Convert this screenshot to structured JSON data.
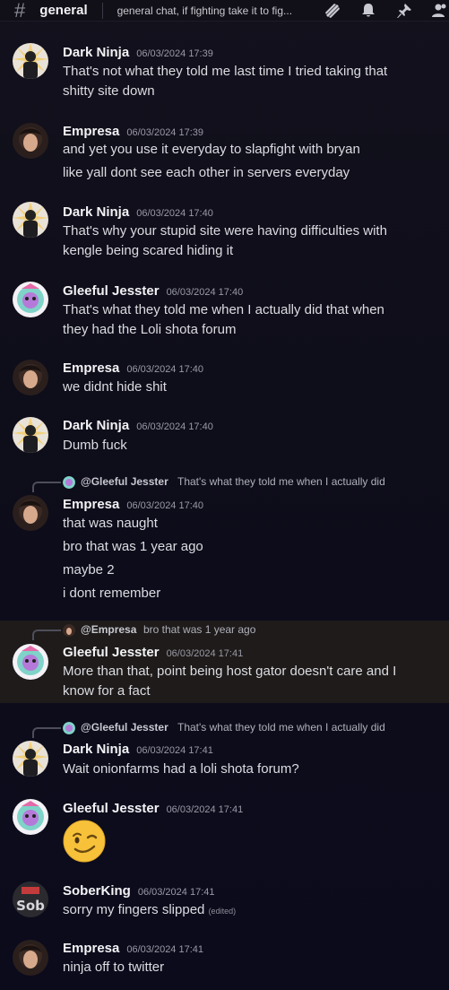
{
  "header": {
    "channel_icon": "hash-icon",
    "channel": "general",
    "topic": "general chat, if fighting take it to fig...",
    "icons": [
      "threads-icon",
      "bell-icon",
      "pin-icon",
      "members-icon"
    ]
  },
  "users": {
    "dark_ninja": "Dark Ninja",
    "empresa": "Empresa",
    "gleeful": "Gleeful Jesster",
    "soberking": "SoberKing"
  },
  "messages": [
    {
      "author": "Dark Ninja",
      "time": "06/03/2024 17:39",
      "lines": [
        "That's not what they told me last time I tried taking that",
        "shitty site down"
      ]
    },
    {
      "author": "Empresa",
      "time": "06/03/2024 17:39",
      "lines": [
        "and yet you use it everyday to slapfight with bryan",
        "like yall dont see each other in servers everyday"
      ]
    },
    {
      "author": "Dark Ninja",
      "time": "06/03/2024 17:40",
      "lines": [
        "That's why your stupid site were having difficulties with",
        "kengle being scared hiding it"
      ]
    },
    {
      "author": "Gleeful Jesster",
      "time": "06/03/2024 17:40",
      "lines": [
        "That's what they told me when I actually did that when",
        "they had the Loli shota forum"
      ]
    },
    {
      "author": "Empresa",
      "time": "06/03/2024 17:40",
      "lines": [
        "we didnt hide shit"
      ]
    },
    {
      "author": "Dark Ninja",
      "time": "06/03/2024 17:40",
      "lines": [
        "Dumb fuck"
      ]
    },
    {
      "author": "Empresa",
      "time": "06/03/2024 17:40",
      "reply_to": "@Gleeful Jesster",
      "reply_text": "That's what they told me when I actually did",
      "lines": [
        "that was naught",
        "bro that was 1 year ago",
        "maybe 2",
        "i dont remember"
      ]
    },
    {
      "author": "Gleeful Jesster",
      "time": "06/03/2024 17:41",
      "reply_to": "@Empresa",
      "reply_text": "bro that was 1 year ago",
      "lines": [
        "More than that, point being host gator doesn't care and I",
        "know for a fact"
      ]
    },
    {
      "author": "Dark Ninja",
      "time": "06/03/2024 17:41",
      "reply_to": "@Gleeful Jesster",
      "reply_text": "That's what they told me when I actually did",
      "lines": [
        "Wait onionfarms had a loli shota forum?"
      ]
    },
    {
      "author": "Gleeful Jesster",
      "time": "06/03/2024 17:41",
      "emoji": "winking-face-emoji",
      "lines": []
    },
    {
      "author": "SoberKing",
      "time": "06/03/2024 17:41",
      "lines": [
        "sorry my fingers slipped"
      ],
      "edited": "(edited)"
    },
    {
      "author": "Empresa",
      "time": "06/03/2024 17:41",
      "lines": [
        "ninja off to twitter"
      ]
    }
  ],
  "colors": {
    "background": "#0e0d1a",
    "highlight": "#1e1b1a",
    "name": "#f3f3f6",
    "text": "#dcdce2",
    "timestamp": "#9a9aa6"
  }
}
